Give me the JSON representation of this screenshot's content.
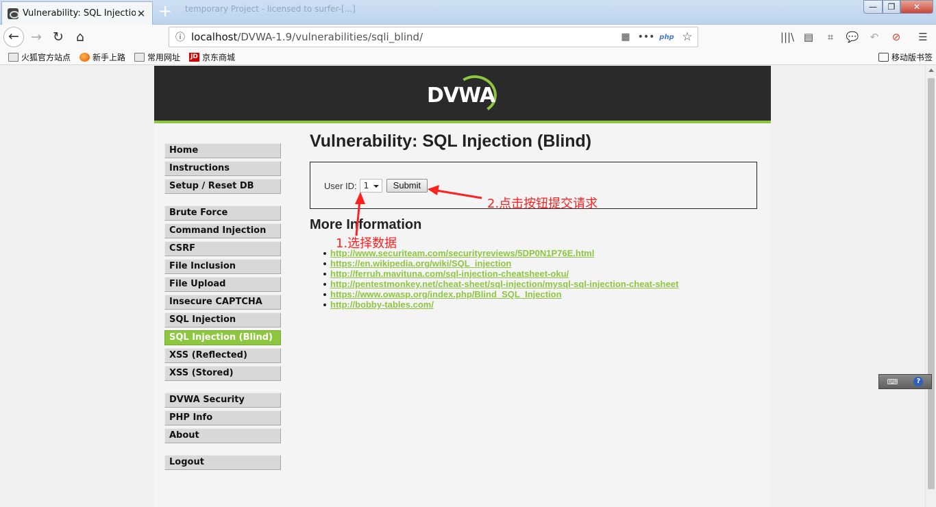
{
  "browser": {
    "tab_title": "Vulnerability: SQL Injection (",
    "tab_close": "✕",
    "new_tab": "+",
    "ghost_title": "temporary Project - licensed to surfer-[...]",
    "window_controls": {
      "minimize": "—",
      "maximize": "❐",
      "close": "✕"
    },
    "nav": {
      "back": "←",
      "forward": "→",
      "reload": "↻",
      "home": "⌂"
    },
    "url": {
      "host": "localhost",
      "path": "/DVWA-1.9/vulnerabilities/sqli_blind/",
      "info_icon": "ⓘ",
      "qr_icon": "▦",
      "more_icon": "•••",
      "php_icon": "php",
      "star_icon": "☆"
    },
    "toolbar_icons": [
      "library-icon",
      "sidebar-icon",
      "crop-icon",
      "chat-icon",
      "undo-icon",
      "block-icon",
      "menu-icon"
    ],
    "toolbar_glyphs": {
      "library": "|||\\",
      "sidebar": "▤",
      "crop": "⌗",
      "chat": "💬",
      "undo": "↶",
      "block": "⊘",
      "menu": "☰"
    },
    "bookmarks": [
      {
        "label": "火狐官方站点",
        "icon": "folder-icon"
      },
      {
        "label": "新手上路",
        "icon": "firefox-icon"
      },
      {
        "label": "常用网址",
        "icon": "folder-icon"
      },
      {
        "label": "京东商城",
        "icon": "jd-icon",
        "icon_text": "JD"
      }
    ],
    "mobile_bookmarks": "移动版书签"
  },
  "page": {
    "logo_text": "DVWA",
    "title": "Vulnerability: SQL Injection (Blind)",
    "form": {
      "label": "User ID:",
      "selected_value": "1",
      "submit_label": "Submit"
    },
    "more_info_heading": "More Information",
    "links": [
      "http://www.securiteam.com/securityreviews/5DP0N1P76E.html",
      "https://en.wikipedia.org/wiki/SQL_injection",
      "http://ferruh.mavituna.com/sql-injection-cheatsheet-oku/",
      "http://pentestmonkey.net/cheat-sheet/sql-injection/mysql-sql-injection-cheat-sheet",
      "https://www.owasp.org/index.php/Blind_SQL_Injection",
      "http://bobby-tables.com/"
    ]
  },
  "menu": {
    "group1": [
      "Home",
      "Instructions",
      "Setup / Reset DB"
    ],
    "group2": [
      "Brute Force",
      "Command Injection",
      "CSRF",
      "File Inclusion",
      "File Upload",
      "Insecure CAPTCHA",
      "SQL Injection",
      "SQL Injection (Blind)",
      "XSS (Reflected)",
      "XSS (Stored)"
    ],
    "group3": [
      "DVWA Security",
      "PHP Info",
      "About"
    ],
    "group4": [
      "Logout"
    ],
    "selected": "SQL Injection (Blind)"
  },
  "annotations": {
    "step1": "1.选择数据",
    "step2": "2.点击按钮提交请求"
  },
  "ime": {
    "keyboard": "⌨",
    "help": "?"
  },
  "colors": {
    "accent": "#8dc63f",
    "header_bg": "#2a2a2a",
    "annotation": "#ff2020"
  }
}
